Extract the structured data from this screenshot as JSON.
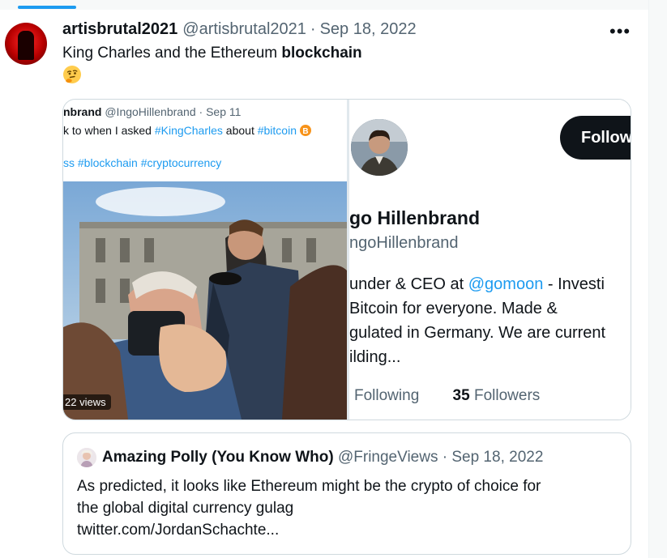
{
  "tweet": {
    "display_name": "artisbrutal2021",
    "handle": "@artisbrutal2021",
    "separator": "·",
    "date": "Sep 18, 2022",
    "more_label": "•••",
    "text_plain": "King Charles and the Ethereum ",
    "text_bold": "blockchain",
    "emoji": "thinking-face-icon"
  },
  "media": {
    "left": {
      "name_partial": "nbrand",
      "handle": "@IngoHillenbrand",
      "date": "Sep 11",
      "line2_plain": "k to when I asked ",
      "line2_hash1": "#KingCharles",
      "line2_mid": " about ",
      "line2_hash2": "#bitcoin",
      "line3_hash": "ss #blockchain #cryptocurrency",
      "views": "22 views"
    },
    "right": {
      "follow_label": "Follow",
      "name": "go Hillenbrand",
      "handle": "ngoHillenbrand",
      "bio_line1_plain": "under & CEO at ",
      "bio_line1_mention": "@gomoon",
      "bio_line1_rest": " - Investi",
      "bio_line2": "Bitcoin for everyone. Made &",
      "bio_line3": "gulated in Germany. We are current",
      "bio_line4": "ilding...",
      "following_label": "Following",
      "followers_count": "35",
      "followers_label": "Followers"
    }
  },
  "quote": {
    "name": "Amazing Polly (You Know Who)",
    "handle": "@FringeViews",
    "separator": "·",
    "date": "Sep 18, 2022",
    "text_line1": "As predicted, it looks like Ethereum might be the crypto of choice for",
    "text_line2": "the global digital currency gulag",
    "text_line3": "twitter.com/JordanSchachte..."
  },
  "colors": {
    "accent": "#1d9bf0",
    "text": "#0f1419",
    "muted": "#536471",
    "border": "#cfd9de",
    "bitcoin": "#f7931a"
  }
}
